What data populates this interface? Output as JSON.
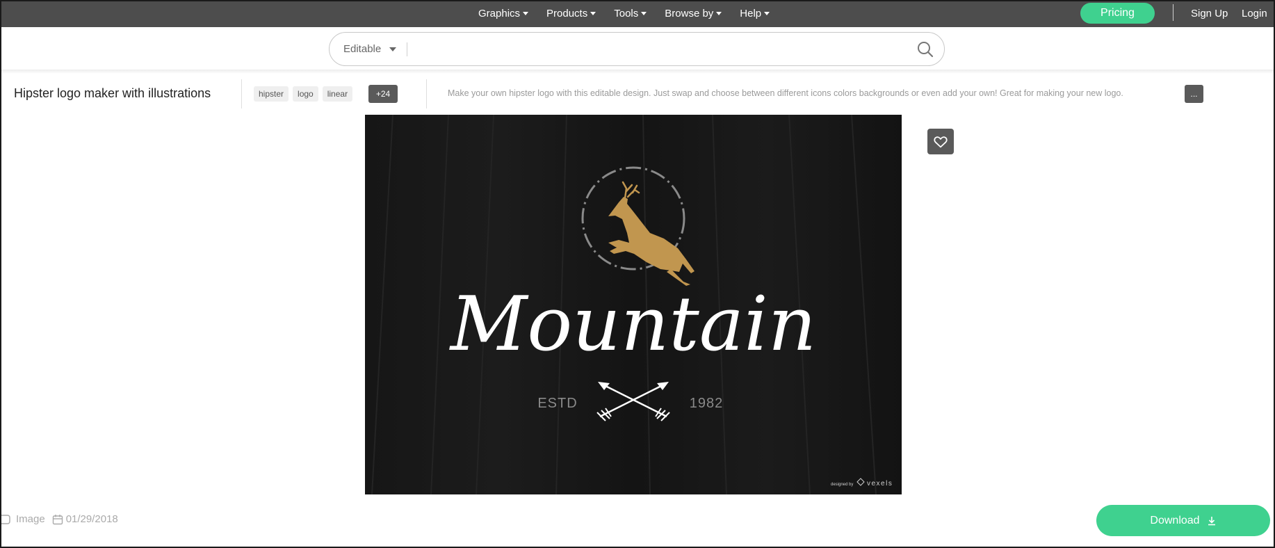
{
  "nav": {
    "items": [
      {
        "label": "Graphics"
      },
      {
        "label": "Products"
      },
      {
        "label": "Tools"
      },
      {
        "label": "Browse by"
      },
      {
        "label": "Help"
      }
    ],
    "pricing_label": "Pricing",
    "signup_label": "Sign Up",
    "login_label": "Login"
  },
  "search": {
    "filter_value": "Editable",
    "placeholder": "",
    "icon": "search-icon"
  },
  "asset": {
    "title": "Hipster logo maker with illustrations",
    "tags": [
      "hipster",
      "logo",
      "linear"
    ],
    "more_tags_label": "+24",
    "description": "Make your own hipster logo with this editable design. Just swap and choose between different icons colors backgrounds or even add your own! Great for making your new logo.",
    "expand_label": "...",
    "favorite_icon": "heart-icon"
  },
  "preview": {
    "brand_name": "Mountain",
    "left_text": "ESTD",
    "right_text": "1982",
    "watermark_prefix": "designed by",
    "watermark_brand": "vexels",
    "colors": {
      "background": "#141414",
      "deer": "#c1964f",
      "text": "#ffffff",
      "muted": "#8a8a8a"
    }
  },
  "footer": {
    "type_icon": "hd-icon",
    "type_label": "Image",
    "date_icon": "calendar-icon",
    "date": "01/29/2018",
    "download_label": "Download",
    "download_icon": "download-icon"
  },
  "colors": {
    "nav_bg": "#4d4d4d",
    "accent": "#3fd18f",
    "tag_dark": "#5a5a5a"
  }
}
